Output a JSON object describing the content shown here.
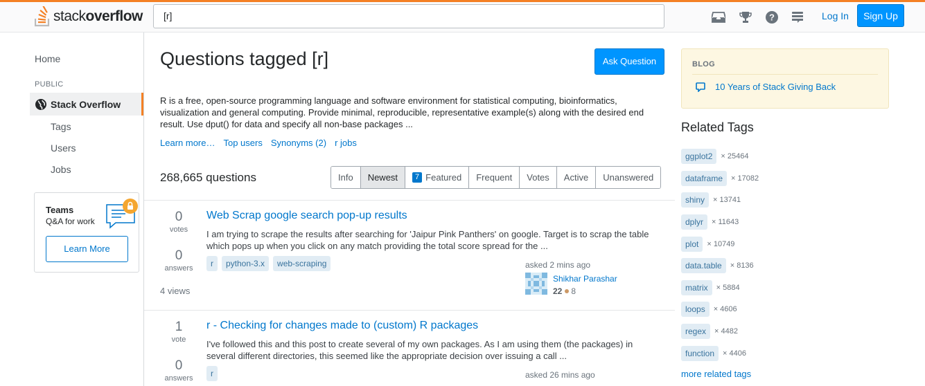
{
  "header": {
    "logo_light": "stack",
    "logo_bold": "overflow",
    "search_value": "[r]",
    "login_label": "Log In",
    "signup_label": "Sign Up"
  },
  "nav": {
    "home": "Home",
    "public": "PUBLIC",
    "stackoverflow": "Stack Overflow",
    "tags": "Tags",
    "users": "Users",
    "jobs": "Jobs"
  },
  "teams": {
    "title": "Teams",
    "subtitle": "Q&A for work",
    "learn_more": "Learn More"
  },
  "main": {
    "title": "Questions tagged [r]",
    "ask_button": "Ask Question",
    "description": "R is a free, open-source programming language and software environment for statistical computing, bioinformatics, visualization and general computing. Provide minimal, reproducible, representative example(s) along with the desired end result. Use dput() for data and specify all non-base packages ...",
    "links": [
      "Learn more…",
      "Top users",
      "Synonyms (2)",
      "r jobs"
    ],
    "question_count": "268,665 questions",
    "tabs": [
      {
        "label": "Info"
      },
      {
        "label": "Newest"
      },
      {
        "label": "Featured",
        "badge": "7"
      },
      {
        "label": "Frequent"
      },
      {
        "label": "Votes"
      },
      {
        "label": "Active"
      },
      {
        "label": "Unanswered"
      }
    ],
    "active_tab": "Newest"
  },
  "questions": [
    {
      "votes": "0",
      "votes_label": "votes",
      "answers": "0",
      "answers_label": "answers",
      "views": "4 views",
      "title": "Web Scrap google search pop-up results",
      "excerpt": "I am trying to scrape the results after searching for 'Jaipur Pink Panthers' on google. Target is to scrap the table which pops up when you click on any match providing the total score spread for the ...",
      "tags": [
        "r",
        "python-3.x",
        "web-scraping"
      ],
      "asked": "asked 2 mins ago",
      "user": "Shikhar Parashar",
      "rep": "22",
      "bronze": "8"
    },
    {
      "votes": "1",
      "votes_label": "vote",
      "answers": "0",
      "answers_label": "answers",
      "title": "r - Checking for changes made to (custom) R packages",
      "excerpt": "I've followed this and this post to create several of my own packages. As I am using them (the packages) in several different directories, this seemed like the appropriate decision over issuing a call ...",
      "tags": [
        "r"
      ],
      "asked": "asked 26 mins ago"
    }
  ],
  "sidebar": {
    "blog_heading": "BLOG",
    "blog_item": "10 Years of Stack Giving Back",
    "related_title": "Related Tags",
    "related_tags": [
      {
        "name": "ggplot2",
        "count": "× 25464"
      },
      {
        "name": "dataframe",
        "count": "× 17082"
      },
      {
        "name": "shiny",
        "count": "× 13741"
      },
      {
        "name": "dplyr",
        "count": "× 11643"
      },
      {
        "name": "plot",
        "count": "× 10749"
      },
      {
        "name": "data.table",
        "count": "× 8136"
      },
      {
        "name": "matrix",
        "count": "× 5884"
      },
      {
        "name": "loops",
        "count": "× 4606"
      },
      {
        "name": "regex",
        "count": "× 4482"
      },
      {
        "name": "function",
        "count": "× 4406"
      }
    ],
    "more_related": "more related tags"
  },
  "colors": {
    "brand_orange": "#f48024",
    "link_blue": "#0077cc",
    "primary_button": "#0095ff",
    "tag_bg": "#e1ecf4",
    "tag_text": "#39739d"
  }
}
